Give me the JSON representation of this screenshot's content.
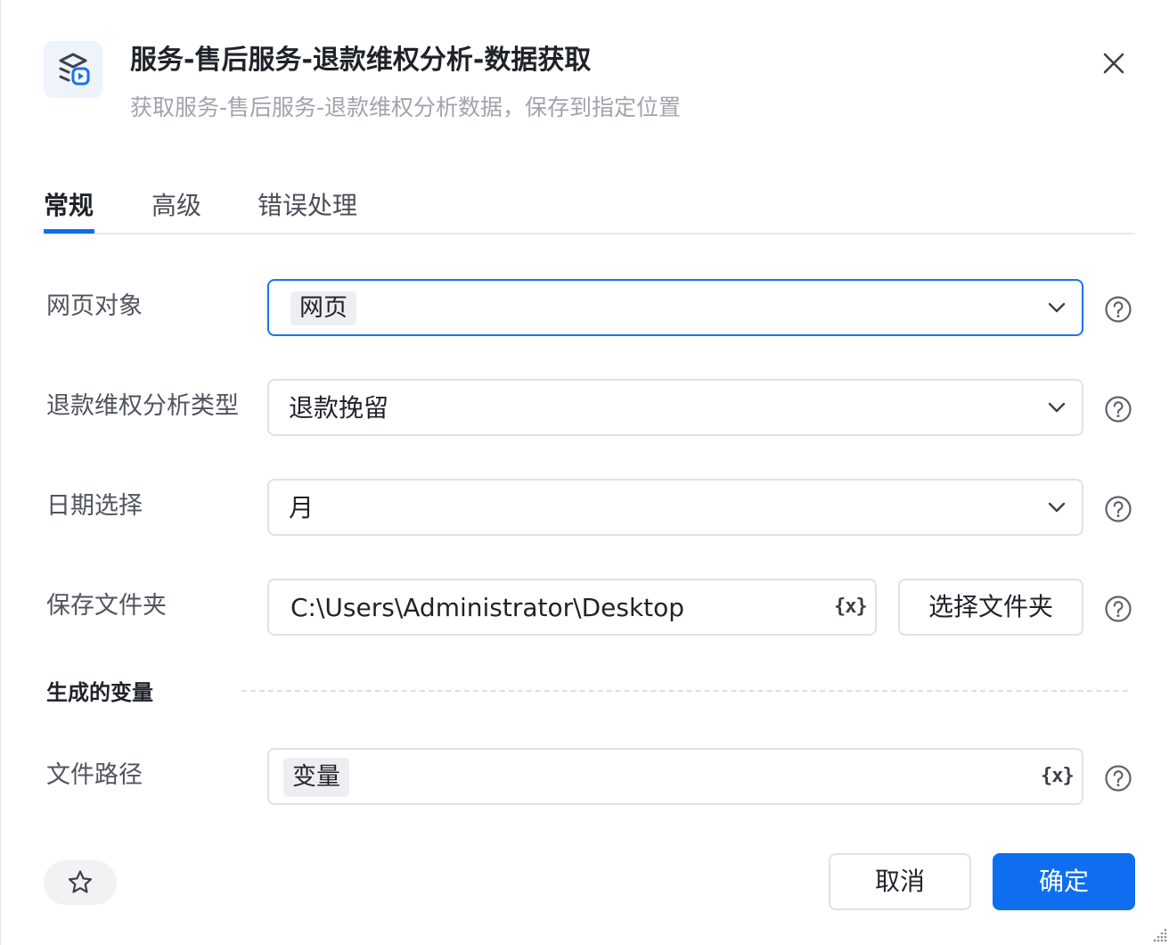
{
  "header": {
    "title": "服务-售后服务-退款维权分析-数据获取",
    "subtitle": "获取服务-售后服务-退款维权分析数据，保存到指定位置",
    "icon": "data-fetch-icon",
    "close_icon": "close-icon"
  },
  "tabs": [
    {
      "label": "常规",
      "active": true
    },
    {
      "label": "高级",
      "active": false
    },
    {
      "label": "错误处理",
      "active": false
    }
  ],
  "fields": {
    "web_object": {
      "label": "网页对象",
      "value": "网页"
    },
    "analysis_type": {
      "label": "退款维权分析类型",
      "value": "退款挽留"
    },
    "date_select": {
      "label": "日期选择",
      "value": "月"
    },
    "save_folder": {
      "label": "保存文件夹",
      "value": "C:\\Users\\Administrator\\Desktop",
      "var_icon": "{x}",
      "button_label": "选择文件夹"
    }
  },
  "generated_vars": {
    "section_title": "生成的变量",
    "file_path": {
      "label": "文件路径",
      "value": "变量",
      "var_icon": "{x}"
    }
  },
  "footer": {
    "cancel_label": "取消",
    "confirm_label": "确定",
    "favorite_icon": "star-icon"
  },
  "colors": {
    "accent": "#0f6ef0",
    "focus_border": "#1a73e8",
    "subtitle": "#a0a4ab"
  }
}
